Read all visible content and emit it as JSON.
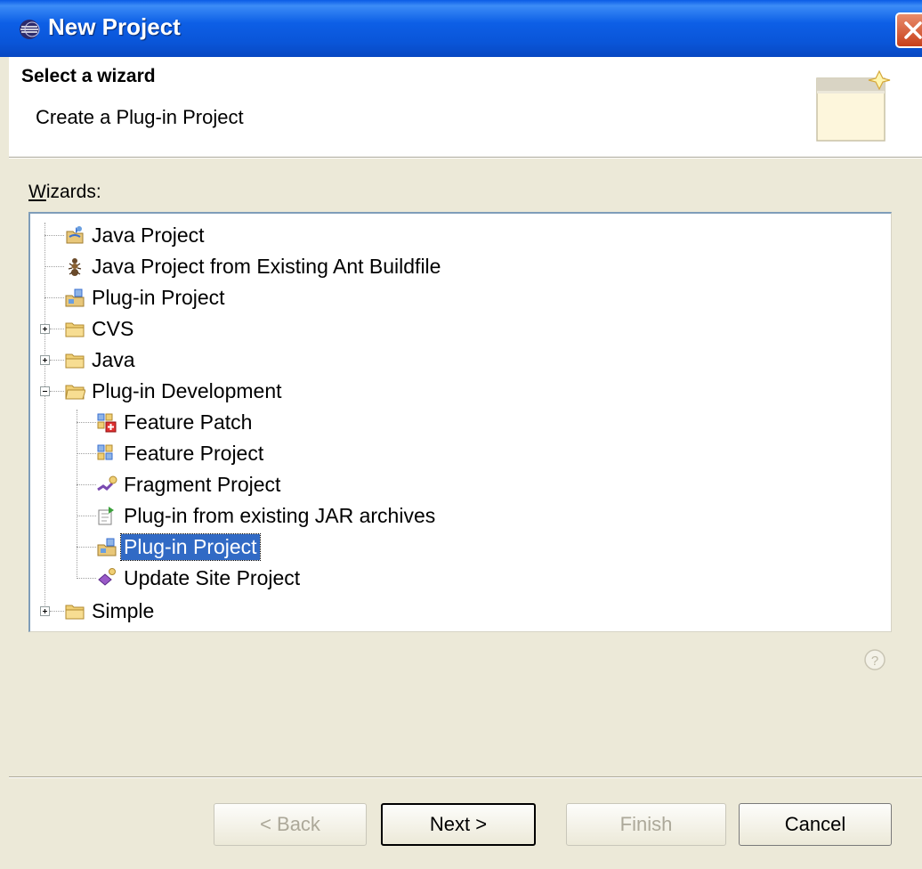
{
  "window": {
    "title": "New Project",
    "icons": {
      "title": "eclipse-icon",
      "close": "close-icon"
    },
    "colors": {
      "titlebar": "#0a5ce6",
      "selection": "#316ac5",
      "dialog_bg": "#ece9d8"
    }
  },
  "banner": {
    "title": "Select a wizard",
    "description": "Create a Plug-in Project",
    "icon": "new-wizard-banner-icon"
  },
  "wizards": {
    "label_underlined": "W",
    "label_rest": "izards:"
  },
  "tree": {
    "items": [
      {
        "label": "Java Project",
        "icon": "java-project-icon",
        "level": 0,
        "expander": null
      },
      {
        "label": "Java Project from Existing Ant Buildfile",
        "icon": "ant-icon",
        "level": 0,
        "expander": null
      },
      {
        "label": "Plug-in Project",
        "icon": "plugin-project-icon",
        "level": 0,
        "expander": null
      },
      {
        "label": "CVS",
        "icon": "folder-icon",
        "level": 0,
        "expander": "collapsed"
      },
      {
        "label": "Java",
        "icon": "folder-icon",
        "level": 0,
        "expander": "collapsed"
      },
      {
        "label": "Plug-in Development",
        "icon": "folder-icon",
        "level": 0,
        "expander": "expanded"
      },
      {
        "label": "Feature Patch",
        "icon": "feature-patch-icon",
        "level": 1,
        "expander": null
      },
      {
        "label": "Feature Project",
        "icon": "feature-project-icon",
        "level": 1,
        "expander": null
      },
      {
        "label": "Fragment Project",
        "icon": "fragment-project-icon",
        "level": 1,
        "expander": null
      },
      {
        "label": "Plug-in from existing JAR archives",
        "icon": "jar-plugin-icon",
        "level": 1,
        "expander": null
      },
      {
        "label": "Plug-in Project",
        "icon": "plugin-project-icon",
        "level": 1,
        "expander": null,
        "selected": true
      },
      {
        "label": "Update Site Project",
        "icon": "update-site-icon",
        "level": 1,
        "expander": null
      },
      {
        "label": "Simple",
        "icon": "folder-icon",
        "level": 0,
        "expander": "collapsed"
      }
    ]
  },
  "help": {
    "icon": "help-icon"
  },
  "buttons": {
    "back": {
      "label": "< Back",
      "enabled": false
    },
    "next": {
      "label": "Next >",
      "enabled": true,
      "default": true
    },
    "finish": {
      "label": "Finish",
      "enabled": false
    },
    "cancel": {
      "label": "Cancel",
      "enabled": true
    }
  }
}
